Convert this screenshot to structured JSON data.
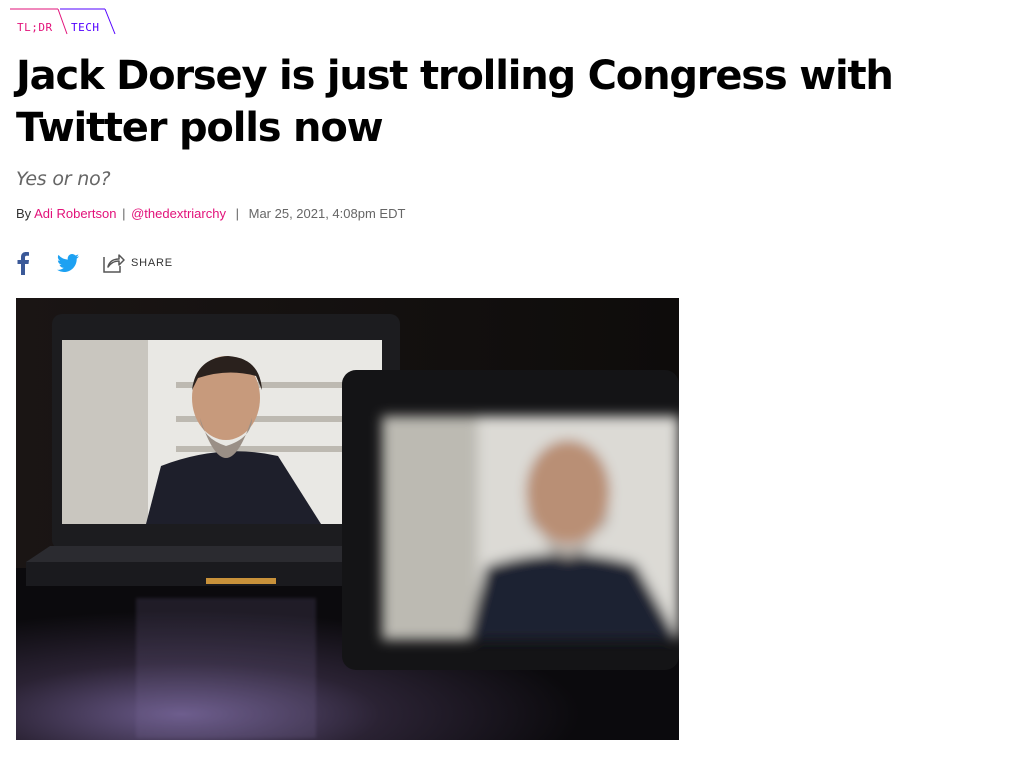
{
  "breadcrumb": {
    "items": [
      {
        "label": "TL;DR",
        "color": "#e2127a"
      },
      {
        "label": "TECH",
        "color": "#5200ff"
      }
    ]
  },
  "article": {
    "title": "Jack Dorsey is just trolling Congress with Twitter polls now",
    "dek": "Yes or no?",
    "byline": {
      "by": "By",
      "author": "Adi Robertson",
      "divider": "|",
      "handle": "@thedextriarchy",
      "divider2": "|",
      "date": "Mar 25, 2021, 4:08pm EDT"
    },
    "share": {
      "facebook_icon": "facebook-icon",
      "twitter_icon": "twitter-icon",
      "share_icon": "share-icon",
      "label": "SHARE"
    },
    "hero_image": {
      "subject": "Jack Dorsey video call on laptop and tablet screens"
    }
  },
  "colors": {
    "accent_pink": "#e2127a",
    "accent_purple": "#5200ff",
    "facebook_blue": "#3b5998",
    "twitter_blue": "#1da1f2"
  }
}
